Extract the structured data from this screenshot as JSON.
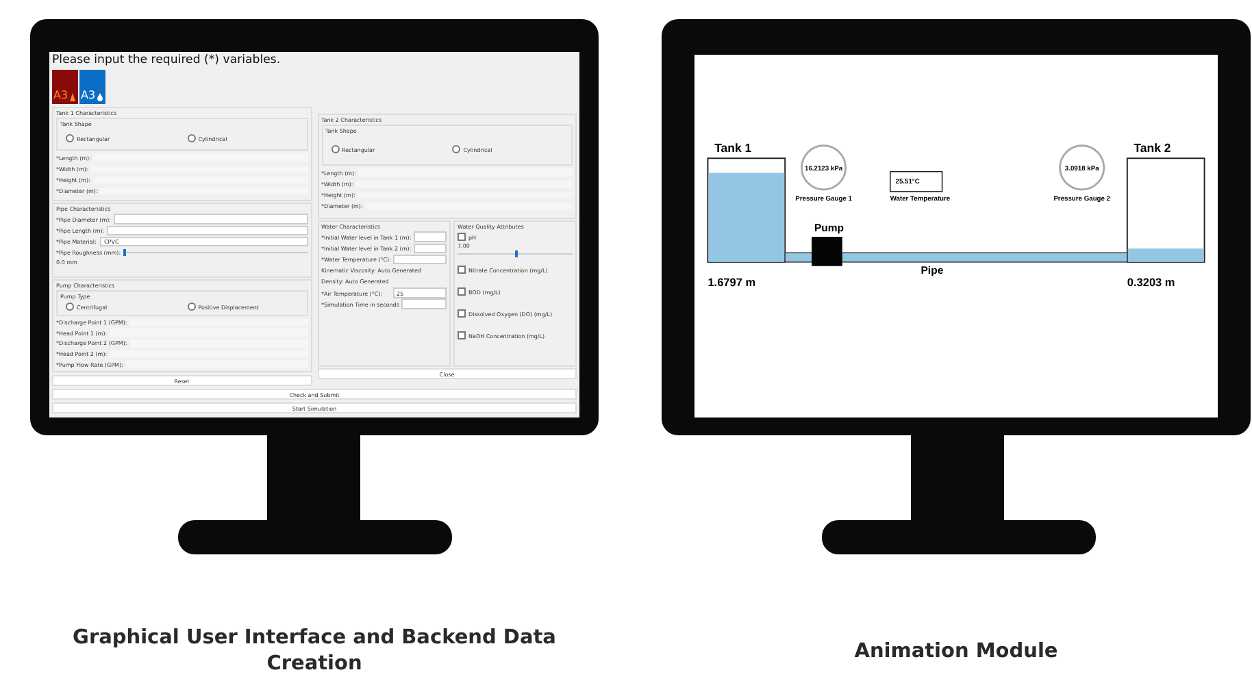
{
  "gui_screen": {
    "title": "Please input the required (*) variables.",
    "logos": [
      {
        "text": "A3",
        "color": "#8b0a0a",
        "kind": "flame"
      },
      {
        "text": "A3",
        "color": "#0b6ec4",
        "kind": "drop"
      }
    ],
    "tank1": {
      "title": "Tank 1 Characteristics",
      "shape_title": "Tank Shape",
      "shapes": [
        {
          "label": "Rectangular",
          "selected": false
        },
        {
          "label": "Cylindrical",
          "selected": false
        }
      ],
      "fields": [
        {
          "label": "*Length (m):",
          "kind": "plain"
        },
        {
          "label": "*Width (m):",
          "kind": "plain"
        },
        {
          "label": "*Height (m):",
          "kind": "plain"
        },
        {
          "label": "*Diameter (m):",
          "kind": "plain"
        }
      ]
    },
    "pipe": {
      "title": "Pipe Characteristics",
      "fields": [
        {
          "label": "*Pipe Diameter (m):",
          "kind": "input"
        },
        {
          "label": "*Pipe Length (m):",
          "kind": "input"
        },
        {
          "label": "*Pipe Material:",
          "kind": "select",
          "value": "CPVC"
        },
        {
          "label": "*Pipe Roughness (mm):",
          "kind": "slider",
          "level": 0,
          "reading": "0.0 mm"
        }
      ]
    },
    "pump": {
      "title": "Pump Characteristics",
      "type_title": "Pump Type",
      "types": [
        {
          "label": "Centrifugal",
          "selected": false
        },
        {
          "label": "Positive Displacement",
          "selected": false
        }
      ],
      "fields": [
        {
          "label": "*Discharge Point 1 (GPM):",
          "kind": "plain"
        },
        {
          "label": "*Head Point 1 (m):",
          "kind": "plain"
        },
        {
          "label": "*Discharge Point 2 (GPM):",
          "kind": "plain"
        },
        {
          "label": "*Head Point 2 (m):",
          "kind": "plain"
        },
        {
          "label": "*Pump Flow Rate (GPM):",
          "kind": "plain"
        }
      ]
    },
    "reset_button": "Reset",
    "tank2": {
      "title": "Tank 2 Characteristics",
      "shape_title": "Tank Shape",
      "shapes": [
        {
          "label": "Rectangular",
          "selected": false
        },
        {
          "label": "Cylindrical",
          "selected": false
        }
      ],
      "fields": [
        {
          "label": "*Length (m):",
          "kind": "plain"
        },
        {
          "label": "*Width (m):",
          "kind": "plain"
        },
        {
          "label": "*Height (m):",
          "kind": "plain"
        },
        {
          "label": "*Diameter (m):",
          "kind": "plain"
        }
      ]
    },
    "water": {
      "title": "Water Characteristics",
      "fields": [
        {
          "label": "*Initial Water level in Tank 1 (m):",
          "kind": "input"
        },
        {
          "label": "*Initial Water level in Tank 2 (m):",
          "kind": "input"
        },
        {
          "label": "*Water Temperature (°C):",
          "kind": "input"
        },
        {
          "label": "Kinematic Viscosity: Auto Generated",
          "kind": "note"
        },
        {
          "label": "Density: Auto Generated",
          "kind": "note"
        },
        {
          "label": "*Air Temperature (°C):",
          "kind": "input",
          "value": "25"
        },
        {
          "label": "*Simulation Time in seconds",
          "kind": "input"
        }
      ]
    },
    "quality": {
      "title": "Water Quality Attributes",
      "items": [
        {
          "label": "pH",
          "checked": false,
          "kind": "slider",
          "level": 0.5,
          "reading": "7.00"
        },
        {
          "label": "Nitrate Concentration (mg/L)",
          "checked": false,
          "kind": "check"
        },
        {
          "label": "BOD (mg/L)",
          "checked": false,
          "kind": "check"
        },
        {
          "label": "Dissolved Oxygen (DO) (mg/L)",
          "checked": false,
          "kind": "check"
        },
        {
          "label": "NaOH Concentration (mg/L)",
          "checked": false,
          "kind": "check"
        }
      ]
    },
    "close_button": "Close",
    "submit_button": "Check and Submit",
    "start_button": "Start Simulation"
  },
  "animation_screen": {
    "tanks": [
      {
        "label": "Tank 1",
        "level": 0.86,
        "reading": "1.6797 m"
      },
      {
        "label": "Tank 2",
        "level": 0.13,
        "reading": "0.3203 m"
      }
    ],
    "gauges": [
      {
        "value": "16.2123 kPa",
        "label": "Pressure Gauge 1"
      },
      {
        "value": "3.0918 kPa",
        "label": "Pressure Gauge 2"
      }
    ],
    "temperature": {
      "value": "25.51°C",
      "label": "Water Temperature"
    },
    "pump": "Pump",
    "pipe": "Pipe"
  },
  "captions": [
    "Graphical User Interface and Backend Data Creation",
    "Animation Module"
  ]
}
